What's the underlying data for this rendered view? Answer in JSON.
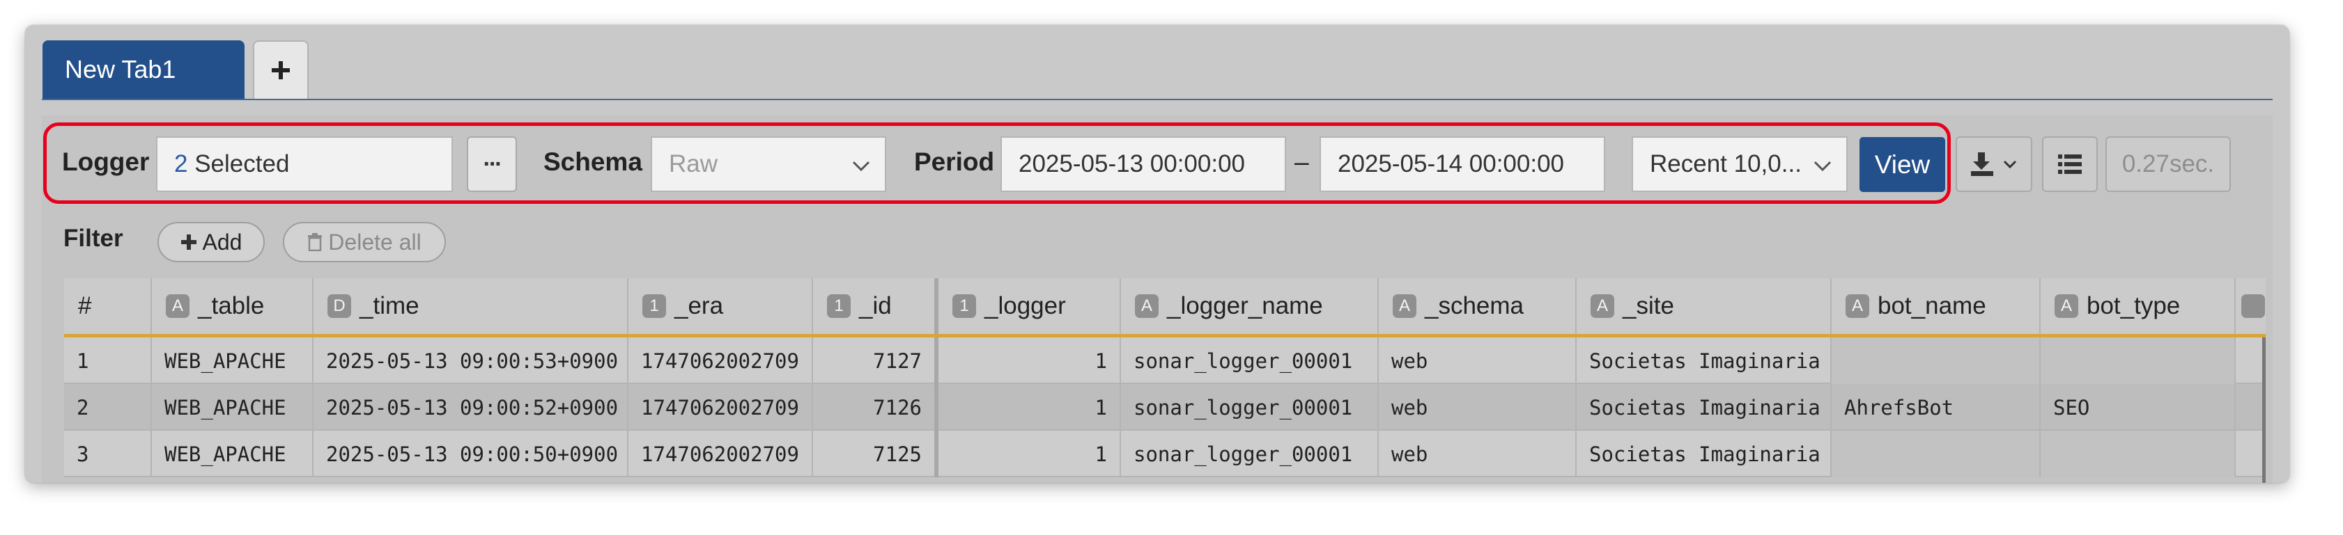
{
  "tabs": [
    {
      "label": "New Tab1"
    }
  ],
  "toolbar": {
    "logger": {
      "label": "Logger",
      "count": "2",
      "selected_text": "Selected"
    },
    "more_button": "···",
    "schema": {
      "label": "Schema",
      "placeholder": "Raw"
    },
    "period": {
      "label": "Period",
      "from": "2025-05-13 00:00:00",
      "separator": "–",
      "to": "2025-05-14 00:00:00"
    },
    "recent": {
      "value": "Recent 10,0..."
    },
    "view_button": "View",
    "elapsed": "0.27sec."
  },
  "filter": {
    "label": "Filter",
    "add": "Add",
    "delete_all": "Delete all"
  },
  "grid": {
    "columns": [
      {
        "type": "",
        "name": "#"
      },
      {
        "type": "A",
        "name": "_table"
      },
      {
        "type": "D",
        "name": "_time"
      },
      {
        "type": "1",
        "name": "_era"
      },
      {
        "type": "1",
        "name": "_id"
      },
      {
        "type": "1",
        "name": "_logger"
      },
      {
        "type": "A",
        "name": "_logger_name"
      },
      {
        "type": "A",
        "name": "_schema"
      },
      {
        "type": "A",
        "name": "_site"
      },
      {
        "type": "A",
        "name": "bot_name"
      },
      {
        "type": "A",
        "name": "bot_type"
      }
    ],
    "rows": [
      [
        "1",
        "WEB_APACHE",
        "2025-05-13 09:00:53+0900",
        "1747062002709",
        "7127",
        "1",
        "sonar_logger_00001",
        "web",
        "Societas Imaginaria",
        "",
        ""
      ],
      [
        "2",
        "WEB_APACHE",
        "2025-05-13 09:00:52+0900",
        "1747062002709",
        "7126",
        "1",
        "sonar_logger_00001",
        "web",
        "Societas Imaginaria",
        "AhrefsBot",
        "SEO"
      ],
      [
        "3",
        "WEB_APACHE",
        "2025-05-13 09:00:50+0900",
        "1747062002709",
        "7125",
        "1",
        "sonar_logger_00001",
        "web",
        "Societas Imaginaria",
        "",
        ""
      ]
    ]
  },
  "icons": {
    "add_tab": "plus-icon",
    "download": "download-icon",
    "columns": "list-icon",
    "filter_add": "plus-icon",
    "delete": "trash-icon"
  }
}
